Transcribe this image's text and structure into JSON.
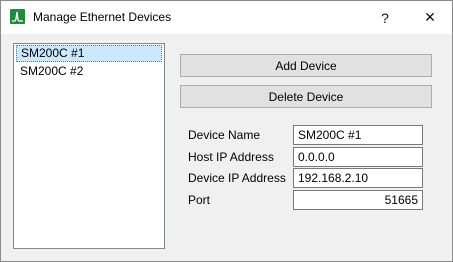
{
  "window": {
    "title": "Manage Ethernet Devices",
    "help_glyph": "?",
    "close_glyph": "✕",
    "icon": "app-waveform-icon",
    "icon_color": "#1e8c3a"
  },
  "device_list": {
    "items": [
      "SM200C #1",
      "SM200C #2"
    ],
    "selected_index": 0
  },
  "buttons": {
    "add_label": "Add Device",
    "delete_label": "Delete Device"
  },
  "fields": {
    "device_name": {
      "label": "Device Name",
      "value": "SM200C #1"
    },
    "host_ip": {
      "label": "Host IP Address",
      "value": "0.0.0.0"
    },
    "device_ip": {
      "label": "Device IP Address",
      "value": "192.168.2.10"
    },
    "port": {
      "label": "Port",
      "value": "51665"
    }
  }
}
